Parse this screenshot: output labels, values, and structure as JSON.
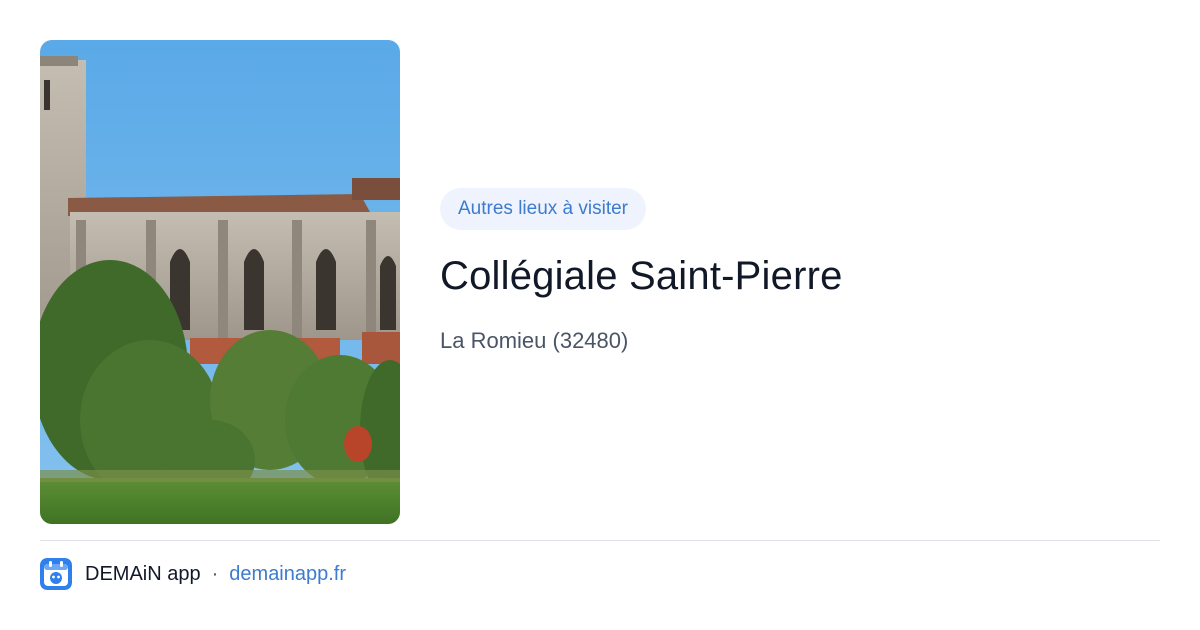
{
  "card": {
    "category": "Autres lieux à visiter",
    "title": "Collégiale Saint-Pierre",
    "location": "La Romieu (32480)"
  },
  "footer": {
    "brand": "DEMAiN app",
    "separator": "·",
    "domain": "demainapp.fr"
  },
  "photo": {
    "subject": "collegiate church exterior with trees"
  },
  "colors": {
    "accent": "#3d7bd0",
    "badge_bg": "#eef3fd",
    "title": "#111827",
    "muted": "#4a5565",
    "divider": "#dfe3e8"
  }
}
